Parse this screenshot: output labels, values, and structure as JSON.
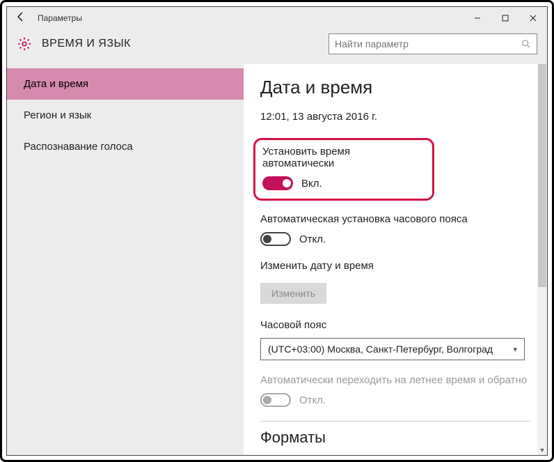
{
  "window": {
    "title": "Параметры"
  },
  "header": {
    "section_title": "ВРЕМЯ И ЯЗЫК",
    "search_placeholder": "Найти параметр"
  },
  "sidebar": {
    "items": [
      {
        "label": "Дата и время",
        "active": true
      },
      {
        "label": "Регион и язык",
        "active": false
      },
      {
        "label": "Распознавание голоса",
        "active": false
      }
    ]
  },
  "content": {
    "heading": "Дата и время",
    "current_datetime": "12:01, 13 августа 2016 г.",
    "auto_time": {
      "label": "Установить время автоматически",
      "state_text": "Вкл.",
      "on": true
    },
    "auto_tz": {
      "label": "Автоматическая установка часового пояса",
      "state_text": "Откл.",
      "on": false
    },
    "change_dt": {
      "label": "Изменить дату и время",
      "button": "Изменить"
    },
    "timezone": {
      "label": "Часовой пояс",
      "value": "(UTC+03:00) Москва, Санкт-Петербург, Волгоград"
    },
    "dst": {
      "label": "Автоматически переходить на летнее время и обратно",
      "state_text": "Откл.",
      "on": false,
      "enabled": false
    },
    "formats_heading": "Форматы"
  },
  "colors": {
    "accent": "#c3105a",
    "sidebar_active": "#d68aad",
    "highlight": "#d41244"
  }
}
